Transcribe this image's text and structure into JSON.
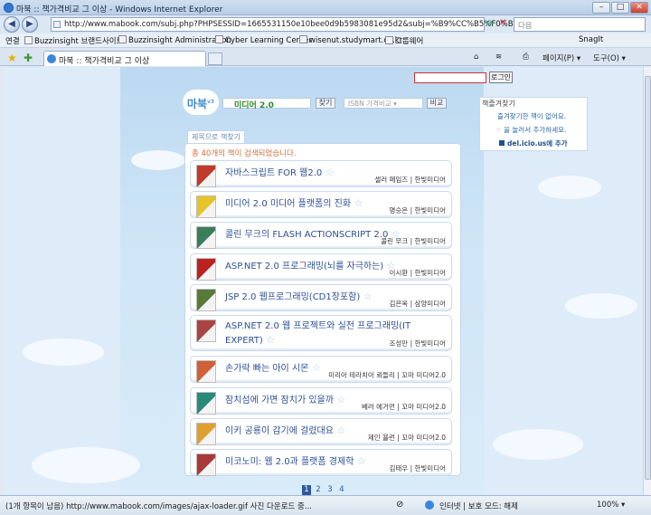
{
  "window": {
    "title": "마북 :: 책가격비교 그 이상 - Windows Internet Explorer",
    "min": "–",
    "max": "□",
    "close": "✕"
  },
  "address": {
    "url": "http://www.mabook.com/subj.php?PHPSESSID=1665531150e10bee0d9b5983081e95d2&subj=%B9%CC%B5%F0%BE%EE+2.0",
    "search_placeholder": "다음"
  },
  "links": {
    "label": "연결",
    "items": [
      "Buzzinsight 브랜드사이트",
      "Buzzinsight Administration",
      "Cyber Learning Center",
      "wisenut.studymart.co.kr",
      "그룹웨어"
    ],
    "snagit": "SnagIt"
  },
  "tab": {
    "title": "마북 :: 책가격비교 그 이상"
  },
  "commands": {
    "page": "페이지(P) ▾",
    "tools": "도구(O) ▾"
  },
  "page": {
    "login_button": "로그인",
    "logo": "마북",
    "logo_ver": "v3",
    "search_value": "미디어 2.0",
    "search_button": "찾기",
    "isbn_select": "ISBN 가격비교  ▾",
    "compare_button": "비교",
    "bookmark_title": "책즐겨찾기",
    "bookmark_lines": [
      "즐겨찾기한 책이 없어요.",
      "을 눌러서 추가하세요.",
      "del.icio.us에 추가"
    ],
    "tab_label": "제목으로 책찾기",
    "result_count": "총 40개의 책이 검색되었습니다.",
    "books": [
      {
        "title": "자바스크립트 FOR 웹2.0",
        "meta": "셀러 페임즈 | 한빛미디어",
        "color": "#c23a2a"
      },
      {
        "title": "미디어 2.0 미디어 플랫폼의 진화",
        "meta": "명승은 | 한빛미디어",
        "color": "#e6c42a"
      },
      {
        "title": "콜린 무크의 FLASH ACTIONSCRIPT 2.0",
        "meta": "콜린 무크 | 한빛미디어",
        "color": "#3a7d5a"
      },
      {
        "title": "ASP.NET 2.0 프로그래밍(뇌를 자극하는)",
        "meta": "이시환 | 한빛미디어",
        "color": "#b22"
      },
      {
        "title": "JSP 2.0 웹프로그래밍(CD1장포함)",
        "meta": "김은옥 | 삼양미디어",
        "color": "#5a7a3a"
      },
      {
        "title": "ASP.NET 2.0 웹 프로젝트와 실전 프로그래밍(IT EXPERT)",
        "meta": "조성만 | 한빛미디어",
        "color": "#a44"
      },
      {
        "title": "손가락 빠는 아이 시몬",
        "meta": "미리아 테라치아 뢰들리 | 꼬마 미디어2.0",
        "color": "#d0603a"
      },
      {
        "title": "잠치섬에 가면 잠치가 있을까",
        "meta": "베러 에거먼 | 꼬마 미디어2.0",
        "color": "#2a8a7a"
      },
      {
        "title": "이키 공룡이 감기에 걸렸대요",
        "meta": "제인 욜런 | 꼬마 미디어2.0",
        "color": "#e0a030"
      },
      {
        "title": "미코노미: 웹 2.0과 플랫폼 경제학",
        "meta": "김태우 | 한빛미디어",
        "color": "#a83a3a"
      }
    ],
    "pages": [
      "1",
      "2",
      "3",
      "4"
    ]
  },
  "status": {
    "text": "(1개 항목이 남음) http://www.mabook.com/images/ajax-loader.gif 사진 다운로드 중...",
    "zone": "인터넷 | 보호 모드: 해제",
    "zoom": "100% ▾"
  }
}
